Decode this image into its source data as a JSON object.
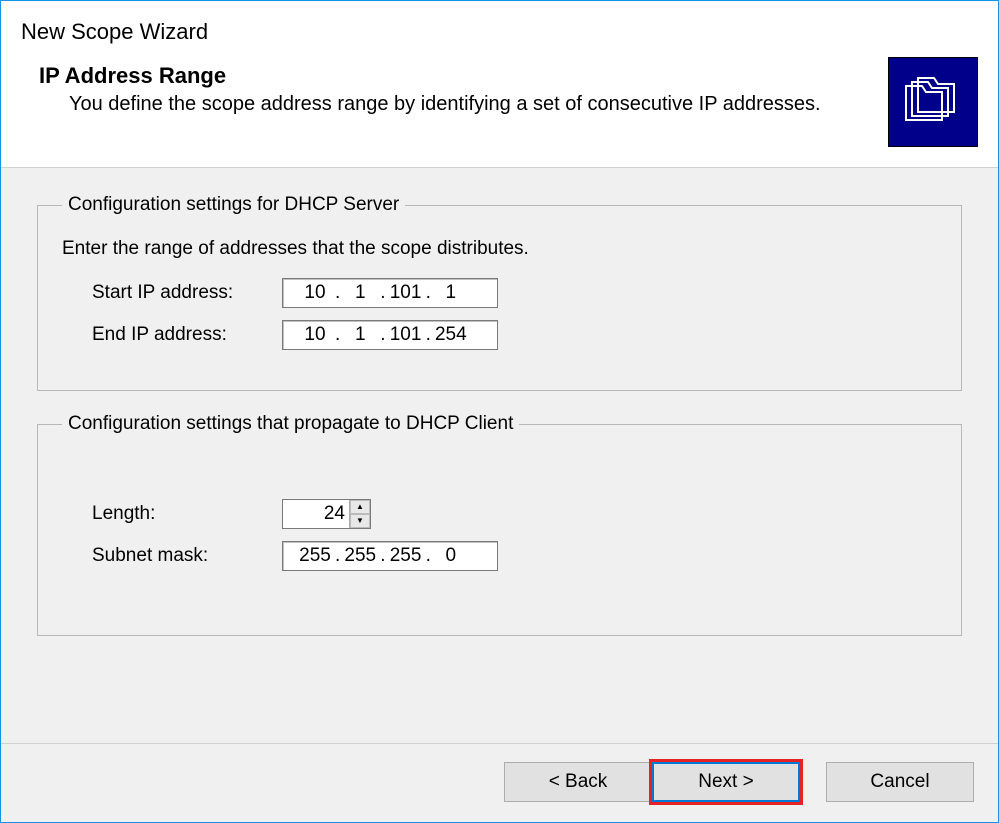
{
  "window_title": "New Scope Wizard",
  "page": {
    "title": "IP Address Range",
    "subtitle": "You define the scope address range by identifying a set of consecutive IP addresses."
  },
  "server_settings": {
    "legend": "Configuration settings for DHCP Server",
    "instruction": "Enter the range of addresses that the scope distributes.",
    "start_ip_label": "Start IP address:",
    "start_ip": {
      "o1": "10",
      "o2": "1",
      "o3": "101",
      "o4": "1"
    },
    "end_ip_label": "End IP address:",
    "end_ip": {
      "o1": "10",
      "o2": "1",
      "o3": "101",
      "o4": "254"
    }
  },
  "client_settings": {
    "legend": "Configuration settings that propagate to DHCP Client",
    "length_label": "Length:",
    "length_value": "24",
    "subnet_label": "Subnet mask:",
    "subnet": {
      "o1": "255",
      "o2": "255",
      "o3": "255",
      "o4": "0"
    }
  },
  "buttons": {
    "back": "< Back",
    "next": "Next >",
    "cancel": "Cancel"
  }
}
